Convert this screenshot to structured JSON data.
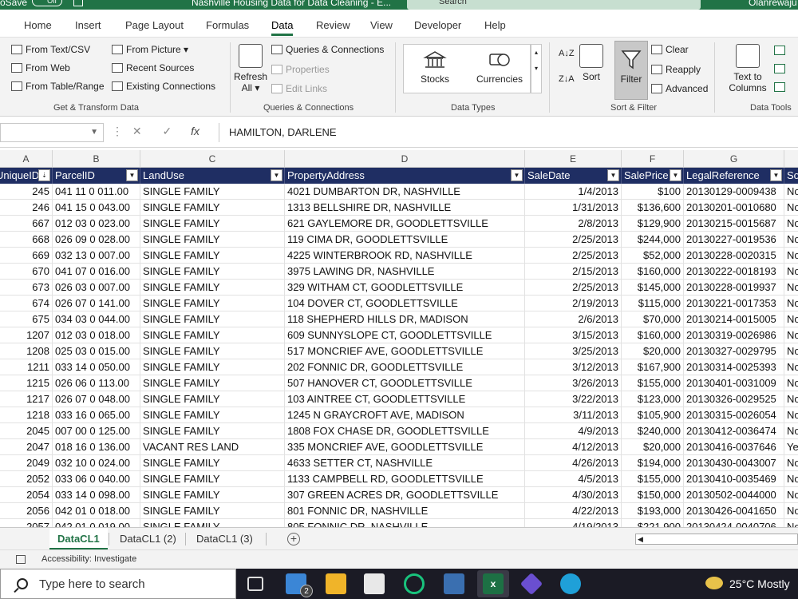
{
  "titlebar": {
    "autosave": "oSave",
    "toggle": "Off",
    "doc_title": "Nashville Housing Data for Data Cleaning - E...",
    "search": "Search",
    "user": "Olanrewaju"
  },
  "menu": [
    "Home",
    "Insert",
    "Page Layout",
    "Formulas",
    "Data",
    "Review",
    "View",
    "Developer",
    "Help"
  ],
  "ribbon": {
    "get_transform": {
      "items": [
        "From Text/CSV",
        "From Web",
        "From Table/Range",
        "From Picture",
        "Recent Sources",
        "Existing Connections"
      ],
      "label": "Get & Transform Data"
    },
    "queries": {
      "refresh": "Refresh",
      "refresh_all": "All",
      "items": [
        "Queries & Connections",
        "Properties",
        "Edit Links"
      ],
      "label": "Queries & Connections"
    },
    "data_types": {
      "stocks": "Stocks",
      "currencies": "Currencies",
      "label": "Data Types"
    },
    "sort_filter": {
      "sort": "Sort",
      "filter": "Filter",
      "clear": "Clear",
      "reapply": "Reapply",
      "advanced": "Advanced",
      "label": "Sort & Filter"
    },
    "data_tools": {
      "text_to": "Text to",
      "columns": "Columns",
      "label": "Data Tools"
    }
  },
  "formula_bar": {
    "name_box": "",
    "fx": "fx",
    "value": "HAMILTON, DARLENE"
  },
  "columns": [
    "A",
    "B",
    "C",
    "D",
    "E",
    "F",
    "G"
  ],
  "headers": [
    "UniqueID",
    "ParcelID",
    "LandUse",
    "PropertyAddress",
    "SaleDate",
    "SalePrice",
    "LegalReference",
    "So"
  ],
  "rows": [
    [
      "245",
      "041 11 0 011.00",
      "SINGLE FAMILY",
      "4021  DUMBARTON DR, NASHVILLE",
      "1/4/2013",
      "$100",
      "20130129-0009438",
      "No"
    ],
    [
      "246",
      "041 15 0 043.00",
      "SINGLE FAMILY",
      "1313  BELLSHIRE DR, NASHVILLE",
      "1/31/2013",
      "$136,600",
      "20130201-0010680",
      "No"
    ],
    [
      "667",
      "012 03 0 023.00",
      "SINGLE FAMILY",
      "621  GAYLEMORE DR, GOODLETTSVILLE",
      "2/8/2013",
      "$129,900",
      "20130215-0015687",
      "No"
    ],
    [
      "668",
      "026 09 0 028.00",
      "SINGLE FAMILY",
      "119  CIMA DR, GOODLETTSVILLE",
      "2/25/2013",
      "$244,000",
      "20130227-0019536",
      "No"
    ],
    [
      "669",
      "032 13 0 007.00",
      "SINGLE FAMILY",
      "4225  WINTERBROOK RD, NASHVILLE",
      "2/25/2013",
      "$52,000",
      "20130228-0020315",
      "No"
    ],
    [
      "670",
      "041 07 0 016.00",
      "SINGLE FAMILY",
      "3975  LAWING DR, NASHVILLE",
      "2/15/2013",
      "$160,000",
      "20130222-0018193",
      "No"
    ],
    [
      "673",
      "026 03 0 007.00",
      "SINGLE FAMILY",
      "329  WITHAM CT, GOODLETTSVILLE",
      "2/25/2013",
      "$145,000",
      "20130228-0019937",
      "No"
    ],
    [
      "674",
      "026 07 0 141.00",
      "SINGLE FAMILY",
      "104  DOVER CT, GOODLETTSVILLE",
      "2/19/2013",
      "$115,000",
      "20130221-0017353",
      "No"
    ],
    [
      "675",
      "034 03 0 044.00",
      "SINGLE FAMILY",
      "118  SHEPHERD HILLS DR, MADISON",
      "2/6/2013",
      "$70,000",
      "20130214-0015005",
      "No"
    ],
    [
      "1207",
      "012 03 0 018.00",
      "SINGLE FAMILY",
      "609  SUNNYSLOPE CT, GOODLETTSVILLE",
      "3/15/2013",
      "$160,000",
      "20130319-0026986",
      "No"
    ],
    [
      "1208",
      "025 03 0 015.00",
      "SINGLE FAMILY",
      "517  MONCRIEF AVE, GOODLETTSVILLE",
      "3/25/2013",
      "$20,000",
      "20130327-0029795",
      "No"
    ],
    [
      "1211",
      "033 14 0 050.00",
      "SINGLE FAMILY",
      "202  FONNIC DR, GOODLETTSVILLE",
      "3/12/2013",
      "$167,900",
      "20130314-0025393",
      "No"
    ],
    [
      "1215",
      "026 06 0 113.00",
      "SINGLE FAMILY",
      "507  HANOVER CT, GOODLETTSVILLE",
      "3/26/2013",
      "$155,000",
      "20130401-0031009",
      "No"
    ],
    [
      "1217",
      "026 07 0 048.00",
      "SINGLE FAMILY",
      "103  AINTREE CT, GOODLETTSVILLE",
      "3/22/2013",
      "$123,000",
      "20130326-0029525",
      "No"
    ],
    [
      "1218",
      "033 16 0 065.00",
      "SINGLE FAMILY",
      "1245  N GRAYCROFT AVE, MADISON",
      "3/11/2013",
      "$105,900",
      "20130315-0026054",
      "No"
    ],
    [
      "2045",
      "007 00 0 125.00",
      "SINGLE FAMILY",
      "1808  FOX CHASE DR, GOODLETTSVILLE",
      "4/9/2013",
      "$240,000",
      "20130412-0036474",
      "No"
    ],
    [
      "2047",
      "018 16 0 136.00",
      "VACANT RES LAND",
      "335  MONCRIEF AVE, GOODLETTSVILLE",
      "4/12/2013",
      "$20,000",
      "20130416-0037646",
      "Ye"
    ],
    [
      "2049",
      "032 10 0 024.00",
      "SINGLE FAMILY",
      "4633  SETTER CT, NASHVILLE",
      "4/26/2013",
      "$194,000",
      "20130430-0043007",
      "No"
    ],
    [
      "2052",
      "033 06 0 040.00",
      "SINGLE FAMILY",
      "1133  CAMPBELL RD, GOODLETTSVILLE",
      "4/5/2013",
      "$155,000",
      "20130410-0035469",
      "No"
    ],
    [
      "2054",
      "033 14 0 098.00",
      "SINGLE FAMILY",
      "307  GREEN ACRES DR, GOODLETTSVILLE",
      "4/30/2013",
      "$150,000",
      "20130502-0044000",
      "No"
    ],
    [
      "2056",
      "042 01 0 018.00",
      "SINGLE FAMILY",
      "801  FONNIC DR, NASHVILLE",
      "4/22/2013",
      "$193,000",
      "20130426-0041650",
      "No"
    ],
    [
      "2057",
      "042 01 0 019.00",
      "SINGLE FAMILY",
      "805  FONNIC DR, NASHVILLE",
      "4/19/2013",
      "$221,900",
      "20130424-0040706",
      "No"
    ]
  ],
  "sheet_tabs": [
    "DataCL1",
    "DataCL1 (2)",
    "DataCL1 (3)"
  ],
  "status": {
    "accessibility": "Accessibility: Investigate"
  },
  "taskbar": {
    "search_placeholder": "Type here to search",
    "mail_badge": "2",
    "weather": "25°C  Mostly"
  },
  "colors": {
    "excel_green": "#217346",
    "header_navy": "#1f2e63",
    "taskbar": "#1b1b25"
  }
}
